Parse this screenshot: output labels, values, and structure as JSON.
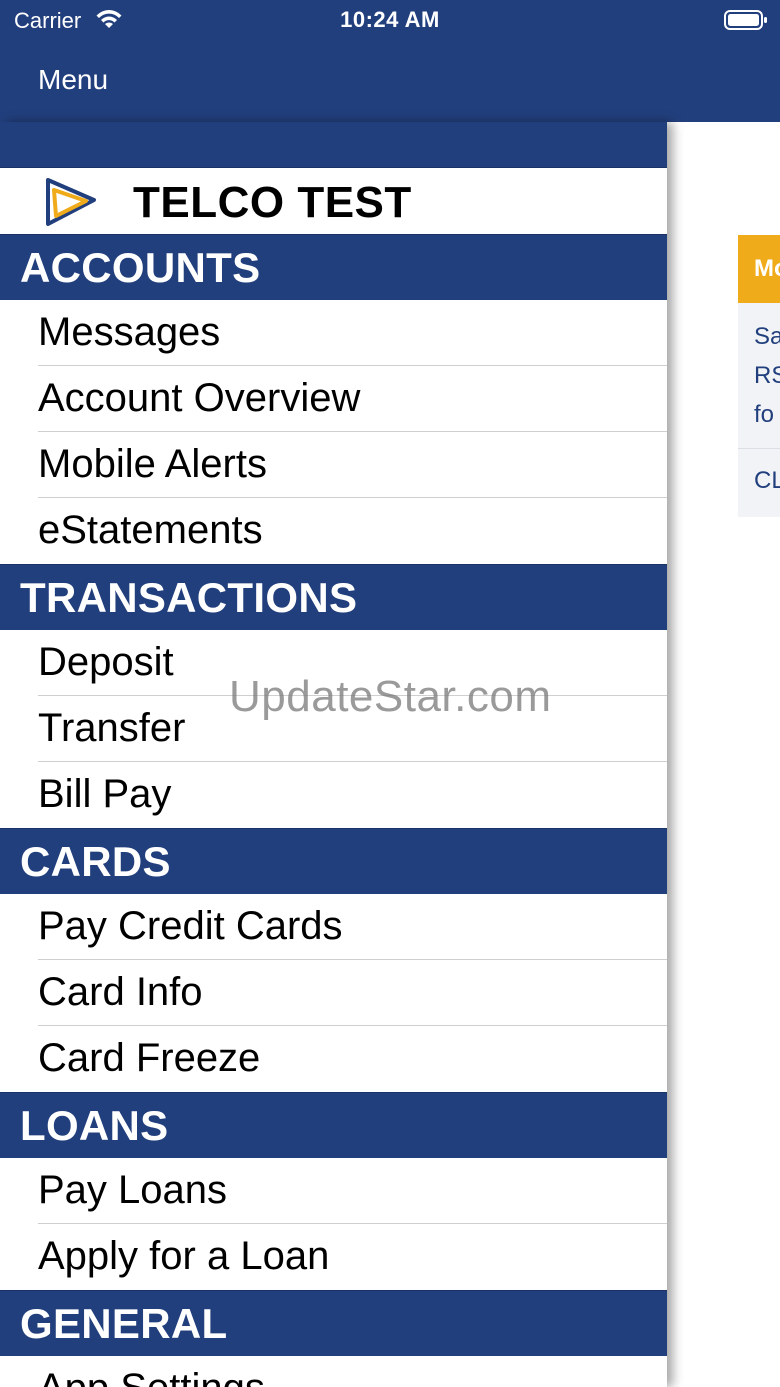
{
  "status_bar": {
    "carrier": "Carrier",
    "time": "10:24 AM"
  },
  "nav": {
    "title": "Menu"
  },
  "drawer": {
    "brand": "TELCO TEST",
    "sections": [
      {
        "title": "ACCOUNTS",
        "items": [
          "Messages",
          "Account Overview",
          "Mobile Alerts",
          "eStatements"
        ]
      },
      {
        "title": "TRANSACTIONS",
        "items": [
          "Deposit",
          "Transfer",
          "Bill Pay"
        ]
      },
      {
        "title": "CARDS",
        "items": [
          "Pay Credit Cards",
          "Card Info",
          "Card Freeze"
        ]
      },
      {
        "title": "LOANS",
        "items": [
          "Pay Loans",
          "Apply for a Loan"
        ]
      },
      {
        "title": "GENERAL",
        "items": [
          "App Settings"
        ]
      }
    ]
  },
  "background_card": {
    "header": "Mo",
    "body_lines": [
      "Sa",
      "RS",
      "fo"
    ],
    "footer": "CL"
  },
  "watermark": "UpdateStar.com",
  "colors": {
    "nav_blue": "#223f7d",
    "accent_orange": "#f0ab1b"
  }
}
